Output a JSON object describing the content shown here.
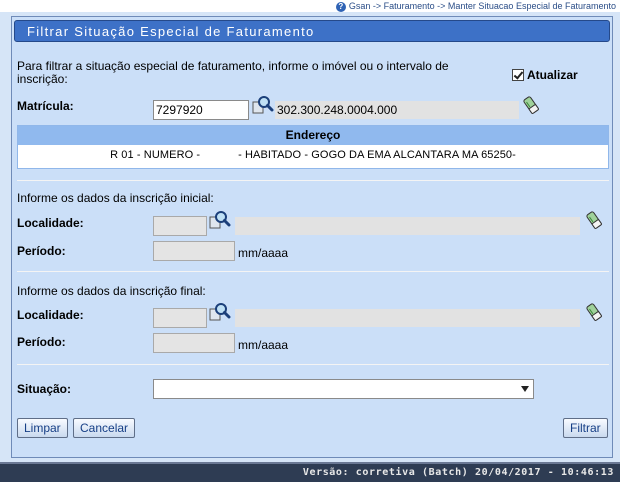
{
  "breadcrumb": "Gsan -> Faturamento -> Manter Situacao Especial de Faturamento",
  "title": "Filtrar Situação Especial de Faturamento",
  "intro": "Para filtrar a situação especial de faturamento, informe o imóvel ou o intervalo de inscrição:",
  "atualizar_label": "Atualizar",
  "atualizar_checked": true,
  "matricula": {
    "label": "Matrícula:",
    "value": "7297920",
    "inscricao": "302.300.248.0004.000"
  },
  "endereco": {
    "header": "Endereço",
    "value": "R 01 - NUMERO -            - HABITADO - GOGO DA EMA ALCANTARA MA 65250-"
  },
  "inicial": {
    "heading": "Informe os dados da inscrição inicial:",
    "localidade_label": "Localidade:",
    "localidade_value": "",
    "periodo_label": "Período:",
    "periodo_value": "",
    "periodo_hint": "mm/aaaa"
  },
  "final": {
    "heading": "Informe os dados da inscrição final:",
    "localidade_label": "Localidade:",
    "localidade_value": "",
    "periodo_label": "Período:",
    "periodo_value": "",
    "periodo_hint": "mm/aaaa"
  },
  "situacao": {
    "label": "Situação:",
    "selected": ""
  },
  "buttons": {
    "limpar": "Limpar",
    "cancelar": "Cancelar",
    "filtrar": "Filtrar"
  },
  "footer": "Versão: corretiva (Batch) 20/04/2017 - 10:46:13",
  "icons": {
    "help": "help-icon",
    "search": "magnifier-icon",
    "clear": "eraser-icon"
  },
  "colors": {
    "title_bar": "#3d71c7",
    "panel_bg": "#cbdff8",
    "table_header": "#90b9ee",
    "footer_bg": "#2e3c53"
  }
}
